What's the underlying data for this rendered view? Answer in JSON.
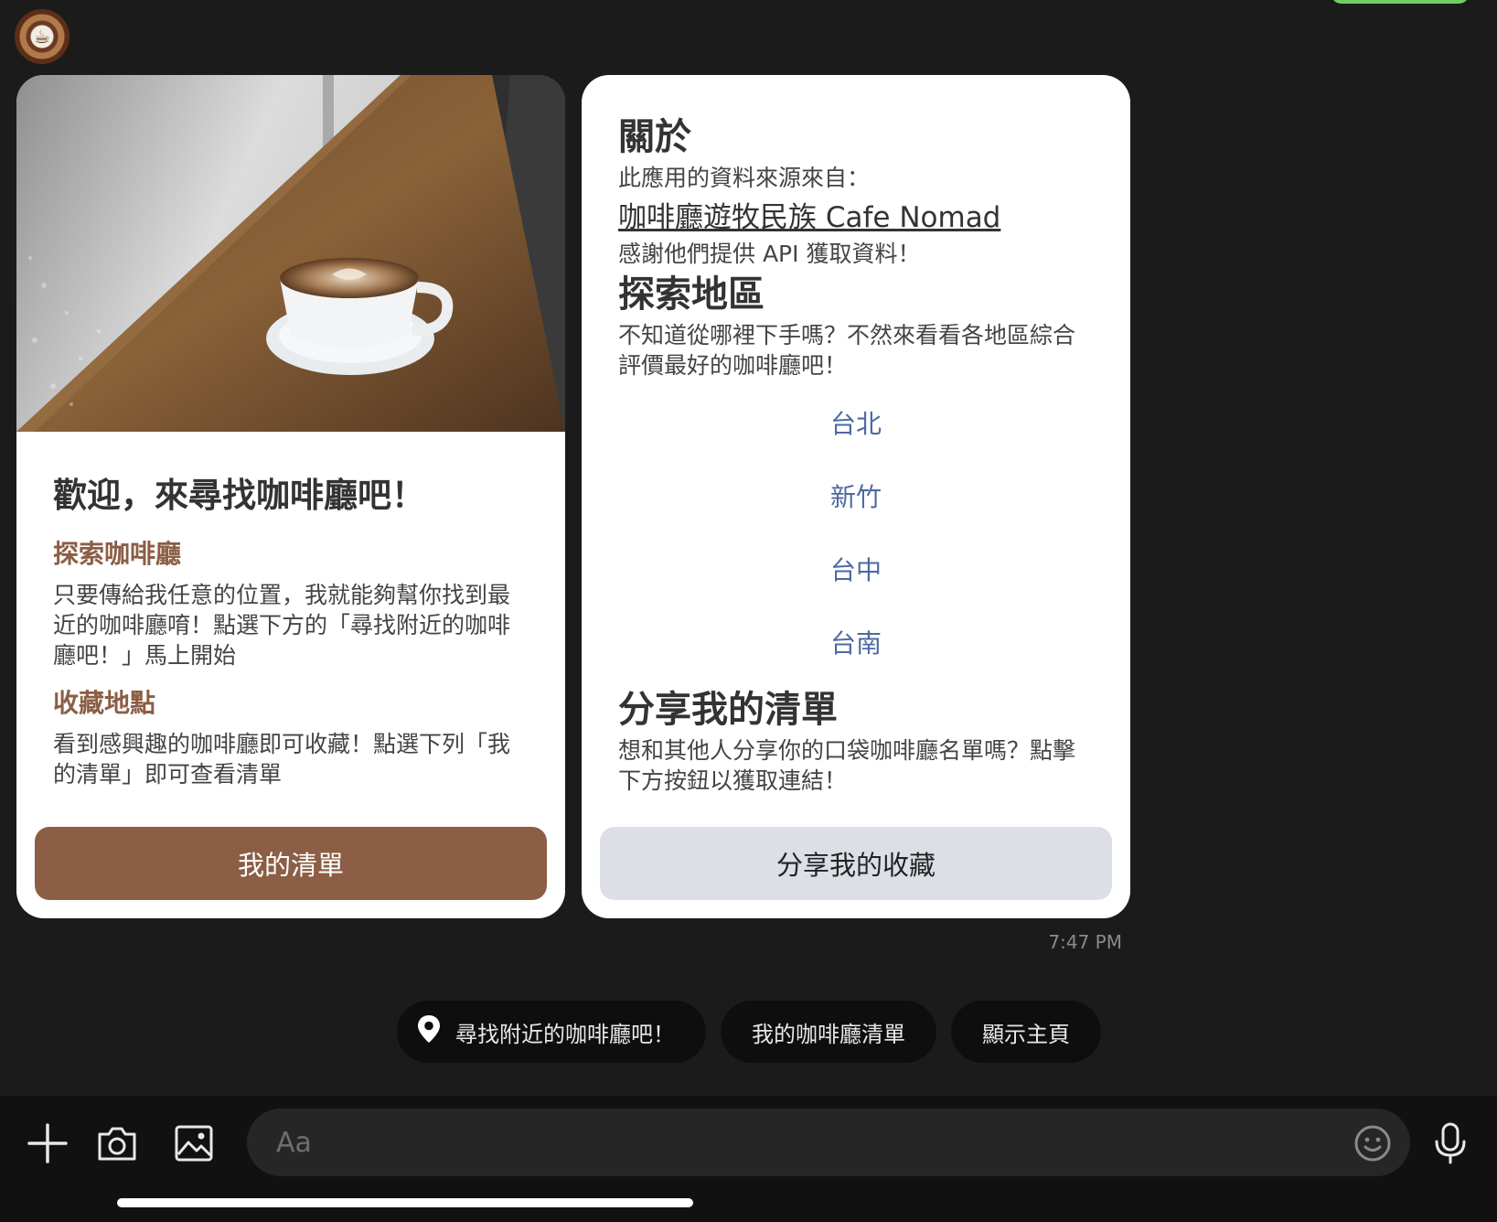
{
  "welcome_card": {
    "title": "歡迎，來尋找咖啡廳吧！",
    "explore_heading": "探索咖啡廳",
    "explore_text": "只要傳給我任意的位置，我就能夠幫你找到最近的咖啡廳唷！點選下方的「尋找附近的咖啡廳吧！」馬上開始",
    "favorites_heading": "收藏地點",
    "favorites_text": "看到感興趣的咖啡廳即可收藏！點選下列「我的清單」即可查看清單",
    "button_label": "我的清單"
  },
  "about_card": {
    "about_heading": "關於",
    "source_intro": "此應用的資料來源來自：",
    "source_link": "咖啡廳遊牧民族 Cafe Nomad",
    "thanks_text": "感謝他們提供 API 獲取資料！",
    "explore_heading": "探索地區",
    "explore_text": "不知道從哪裡下手嗎？不然來看看各地區綜合評價最好的咖啡廳吧！",
    "regions": [
      "台北",
      "新竹",
      "台中",
      "台南"
    ],
    "share_heading": "分享我的清單",
    "share_text": "想和其他人分享你的口袋咖啡廳名單嗎？點擊下方按鈕以獲取連結！",
    "button_label": "分享我的收藏"
  },
  "timestamp": "7:47 PM",
  "quick_replies": [
    {
      "label": "尋找附近的咖啡廳吧！",
      "icon": "location-pin-icon"
    },
    {
      "label": "我的咖啡廳清單"
    },
    {
      "label": "顯示主頁"
    }
  ],
  "composer": {
    "placeholder": "Aa",
    "icons": [
      "plus-icon",
      "camera-icon",
      "image-icon",
      "emoji-icon",
      "microphone-icon"
    ]
  },
  "colors": {
    "background": "#1b1b1b",
    "brand_brown": "#8b5e45",
    "link_blue": "#4d6aa0",
    "secondary_button": "#dcdfe6",
    "accent_green": "#6fcf62"
  }
}
